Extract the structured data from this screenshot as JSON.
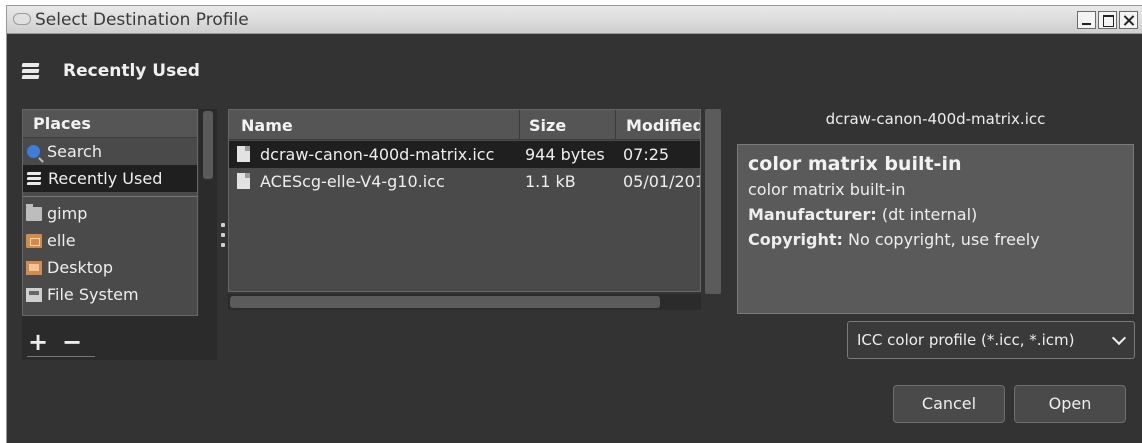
{
  "window": {
    "title": "Select Destination Profile"
  },
  "path_bar": {
    "current": "Recently Used"
  },
  "places": {
    "header": "Places",
    "items": [
      {
        "label": "Search",
        "icon": "search-icon"
      },
      {
        "label": "Recently Used",
        "icon": "recent-icon",
        "selected": true
      },
      {
        "label": "gimp",
        "icon": "folder-icon"
      },
      {
        "label": "elle",
        "icon": "home-folder-icon"
      },
      {
        "label": "Desktop",
        "icon": "desktop-icon"
      },
      {
        "label": "File System",
        "icon": "drive-icon"
      }
    ],
    "add_label": "+",
    "remove_label": "−"
  },
  "file_list": {
    "columns": {
      "name": "Name",
      "size": "Size",
      "modified": "Modified"
    },
    "rows": [
      {
        "name": "dcraw-canon-400d-matrix.icc",
        "size": "944 bytes",
        "modified": "07:25",
        "selected": true
      },
      {
        "name": "ACEScg-elle-V4-g10.icc",
        "size": "1.1 kB",
        "modified": "05/01/201"
      }
    ]
  },
  "preview": {
    "filename": "dcraw-canon-400d-matrix.icc",
    "heading": "color matrix built-in",
    "description": "color matrix built-in",
    "manufacturer_label": "Manufacturer:",
    "manufacturer_value": "(dt internal)",
    "copyright_label": "Copyright:",
    "copyright_value": "No copyright, use freely"
  },
  "filter": {
    "selected": "ICC color profile (*.icc, *.icm)"
  },
  "buttons": {
    "cancel": "Cancel",
    "open": "Open"
  }
}
